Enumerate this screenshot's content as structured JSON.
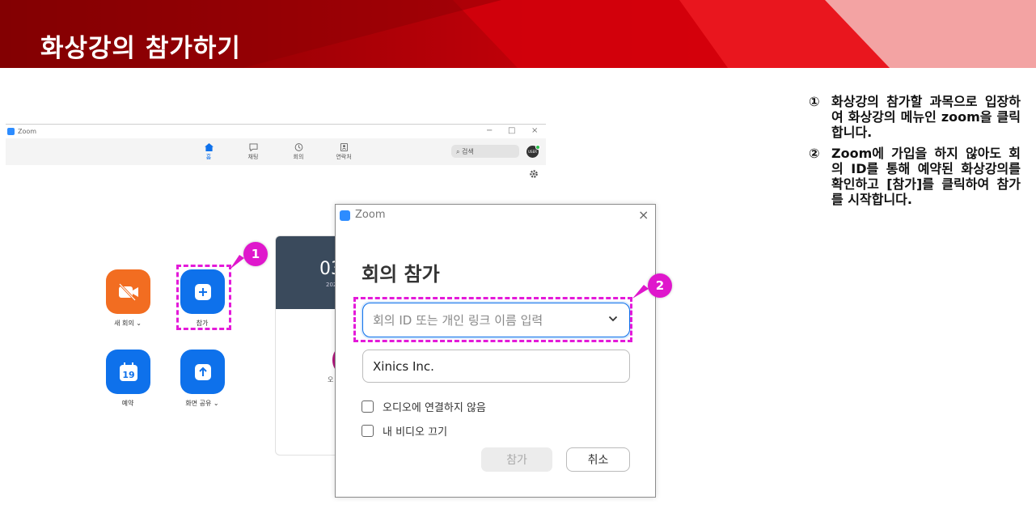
{
  "slide": {
    "title": "화상강의 참가하기",
    "steps": [
      {
        "num": "①",
        "text": "화상강의 참가할 과목으로 입장하여 화상강의 메뉴인 zoom을 클릭합니다."
      },
      {
        "num": "②",
        "text": "Zoom에 가입을 하지 않아도 회의 ID를 통해 예약된 화상강의를 확인하고 [참가]를 클릭하여 참가를 시작합니다."
      }
    ]
  },
  "zoom_window": {
    "title": "Zoom",
    "controls": {
      "minimize": "−",
      "maximize": "□",
      "close": "×"
    },
    "nav": [
      {
        "label": "홈",
        "icon": "home-icon",
        "active": true
      },
      {
        "label": "채팅",
        "icon": "chat-icon",
        "active": false
      },
      {
        "label": "회의",
        "icon": "clock-icon",
        "active": false
      },
      {
        "label": "연락처",
        "icon": "contacts-icon",
        "active": false
      }
    ],
    "search_placeholder": "검색",
    "home_tiles": [
      {
        "label": "새 회의 ⌄",
        "icon": "video-off-icon",
        "color": "#f26d21"
      },
      {
        "label": "참가",
        "icon": "plus-icon",
        "color": "#0e71eb"
      },
      {
        "label": "예약",
        "icon": "calendar-icon",
        "color": "#0e71eb",
        "calendar_day": "19"
      },
      {
        "label": "화면 공유 ⌄",
        "icon": "share-up-icon",
        "color": "#0e71eb"
      }
    ],
    "card": {
      "clock": "03",
      "date": "202",
      "label": "오"
    }
  },
  "join_dialog": {
    "app": "Zoom",
    "close": "×",
    "heading": "회의 참가",
    "meeting_id_placeholder": "회의 ID 또는 개인 링크 이름 입력",
    "name_value": "Xinics Inc.",
    "options": [
      "오디오에 연결하지 않음",
      "내 비디오 끄기"
    ],
    "join_label": "참가",
    "cancel_label": "취소"
  },
  "annotations": {
    "badge_1": "1",
    "badge_2": "2",
    "color": "#e41ad9"
  }
}
